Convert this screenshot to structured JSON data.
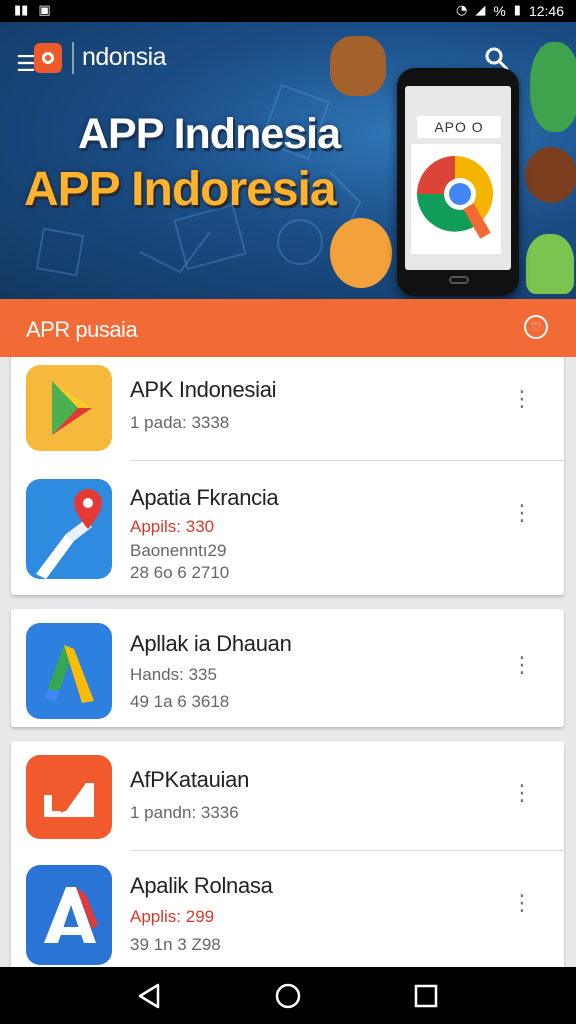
{
  "status_bar": {
    "time": "12:46",
    "battery_text": "%"
  },
  "header": {
    "app_name": "ndonsia",
    "hero_title_white": "APP Indnesia",
    "hero_title_orange": "APP Indoresia",
    "phone_screen_label": "APO O"
  },
  "section": {
    "title": "APR pusaia"
  },
  "apps": [
    {
      "name": "APK Indonesiai",
      "line1": "1 pada: 3338",
      "line2": "",
      "line3": "",
      "line1_red": false
    },
    {
      "name": "Apatia Fkrancia",
      "line1": "Appils: 330",
      "line2": "Baonenntı29",
      "line3": "28 6o 6 2710",
      "line1_red": true
    },
    {
      "name": "Apllak ia Dhauan",
      "line1": "Hands: 335",
      "line2": "49 1a 6 3618",
      "line3": "",
      "line1_red": false
    },
    {
      "name": "AfPKatauian",
      "line1": "1 pandn: 3336",
      "line2": "",
      "line3": "",
      "line1_red": false
    },
    {
      "name": "Apalik Rolnasa",
      "line1": "Applis: 299",
      "line2": "39 1n 3 Z98",
      "line3": "",
      "line1_red": true
    }
  ],
  "colors": {
    "accent": "#f26a36",
    "hero_blue": "#1b4d86",
    "red_text": "#d33a2c"
  },
  "icons": {
    "app0": "play-store-icon",
    "app1": "maps-pin-icon",
    "app2": "google-ads-icon",
    "app3": "orange-chart-icon",
    "app4": "a-letter-icon"
  }
}
